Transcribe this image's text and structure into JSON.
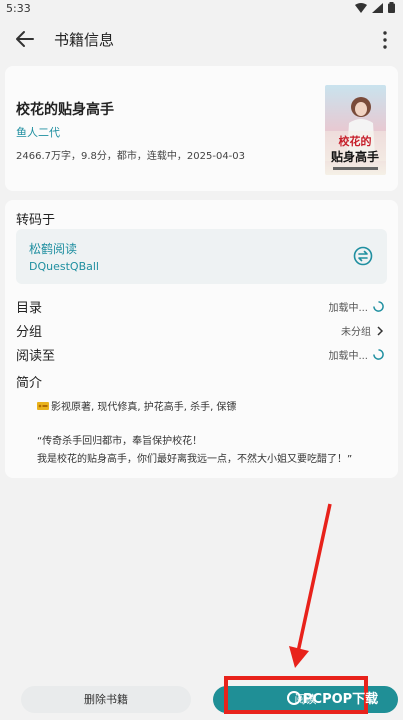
{
  "status": {
    "time": "5:33"
  },
  "appbar": {
    "title": "书籍信息"
  },
  "book": {
    "title": "校花的贴身高手",
    "author": "鱼人二代",
    "meta": "2466.7万字，9.8分，都市，连载中，2025-04-03",
    "cover_text": "校花的贴身高手"
  },
  "source": {
    "section_label": "转码于",
    "name": "松鹤阅读",
    "author": "DQuestQBall"
  },
  "rows": {
    "toc_label": "目录",
    "toc_value": "加载中...",
    "group_label": "分组",
    "group_value": "未分组",
    "progress_label": "阅读至",
    "progress_value": "加载中..."
  },
  "intro": {
    "label": "简介",
    "tags": "影视原著, 现代修真, 护花高手, 杀手, 保镖",
    "line1": "“传奇杀手回归都市，奉旨保护校花！",
    "line2": "我是校花的贴身高手，你们最好离我远一点，不然大小姐又要吃醋了！”"
  },
  "buttons": {
    "delete": "删除书籍",
    "read": "阅读"
  },
  "watermark": "PCPOP下载",
  "colors": {
    "accent": "#1f8fa0",
    "annotation": "#e8221b"
  }
}
